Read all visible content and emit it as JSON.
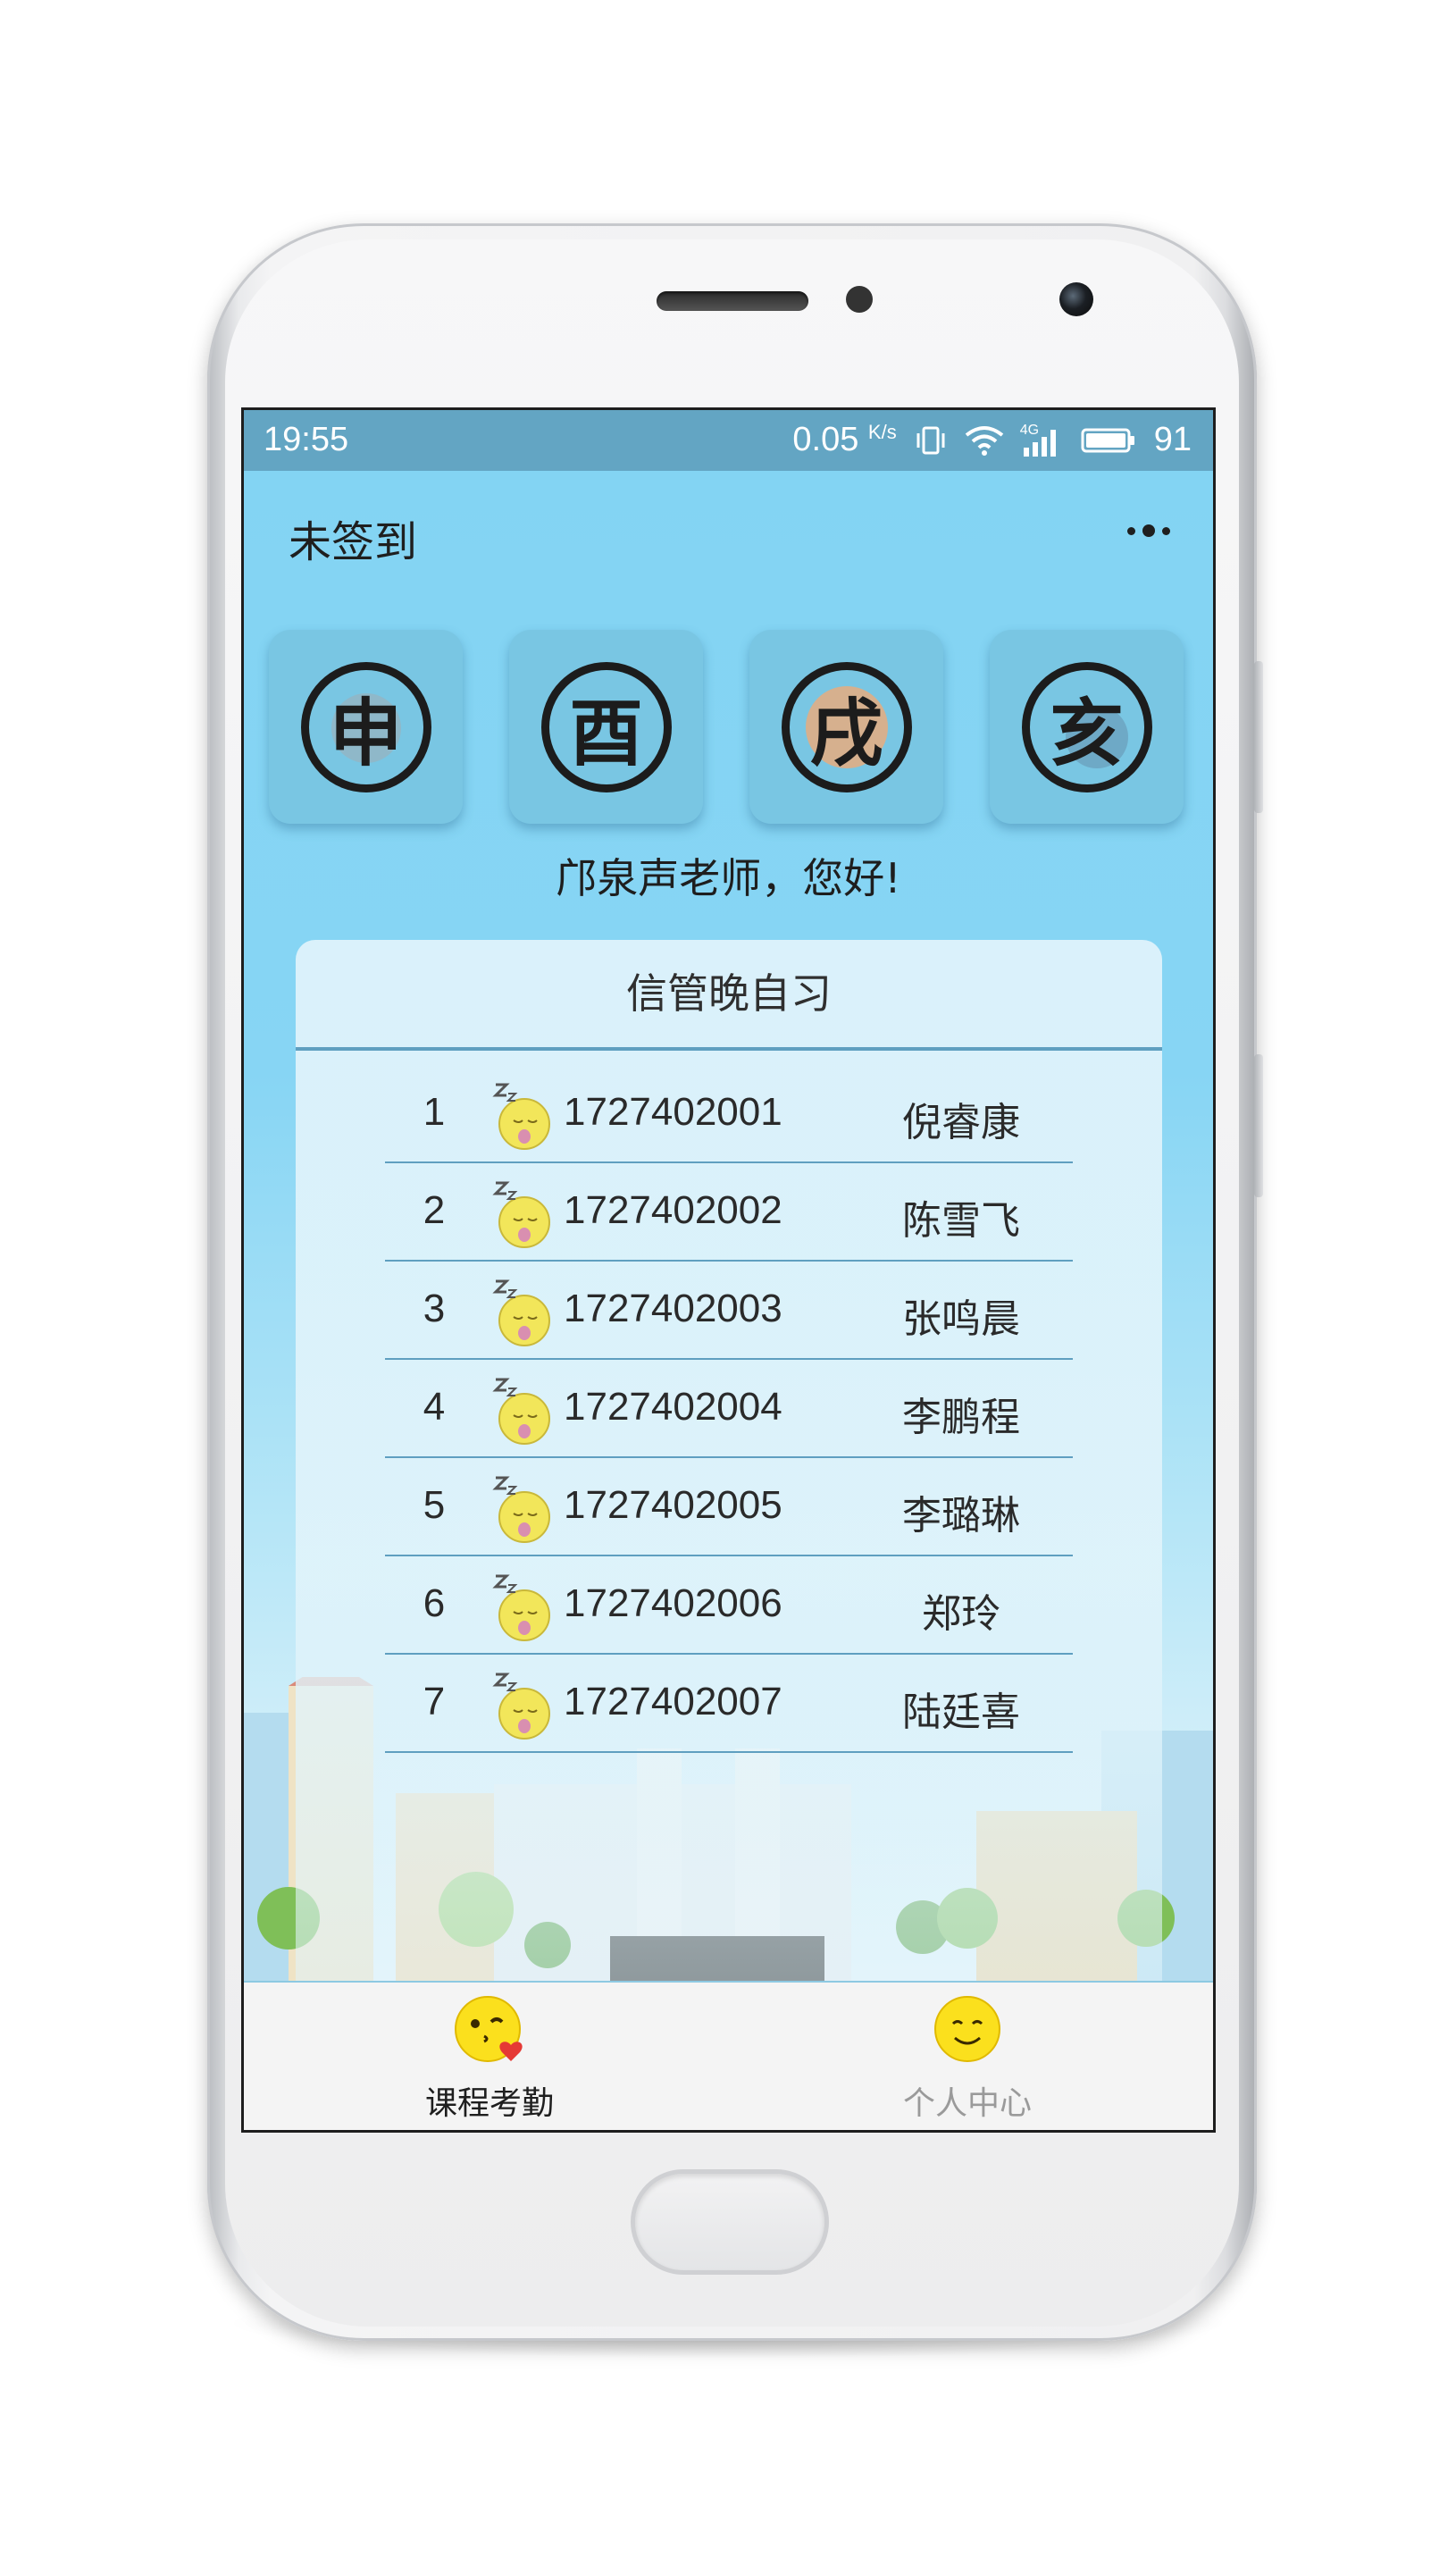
{
  "status_bar": {
    "time": "19:55",
    "net_speed": "0.05",
    "net_unit": "K/s",
    "network_type": "4G",
    "battery": "91"
  },
  "header": {
    "title": "未签到"
  },
  "period_tiles": [
    {
      "char": "申"
    },
    {
      "char": "酉"
    },
    {
      "char": "戌"
    },
    {
      "char": "亥"
    }
  ],
  "greeting": "邝泉声老师，您好!",
  "course": {
    "title": "信管晚自习",
    "students": [
      {
        "no": "1",
        "id": "1727402001",
        "name": "倪睿康"
      },
      {
        "no": "2",
        "id": "1727402002",
        "name": "陈雪飞"
      },
      {
        "no": "3",
        "id": "1727402003",
        "name": "张鸣晨"
      },
      {
        "no": "4",
        "id": "1727402004",
        "name": "李鹏程"
      },
      {
        "no": "5",
        "id": "1727402005",
        "name": "李璐琳"
      },
      {
        "no": "6",
        "id": "1727402006",
        "name": "郑玲"
      },
      {
        "no": "7",
        "id": "1727402007",
        "name": "陆廷喜"
      }
    ]
  },
  "tabbar": {
    "tabs": [
      {
        "label": "课程考勤",
        "icon": "kiss-emoji-icon",
        "active": true
      },
      {
        "label": "个人中心",
        "icon": "smile-emoji-icon",
        "active": false
      }
    ]
  },
  "colors": {
    "status_bar": "#63a5c3",
    "background": "#83d4f3",
    "tile": "#79c6e3",
    "divider": "#5f9fc0",
    "tab_active": "#1e1e1e",
    "tab_inactive": "#9a9a9a"
  }
}
